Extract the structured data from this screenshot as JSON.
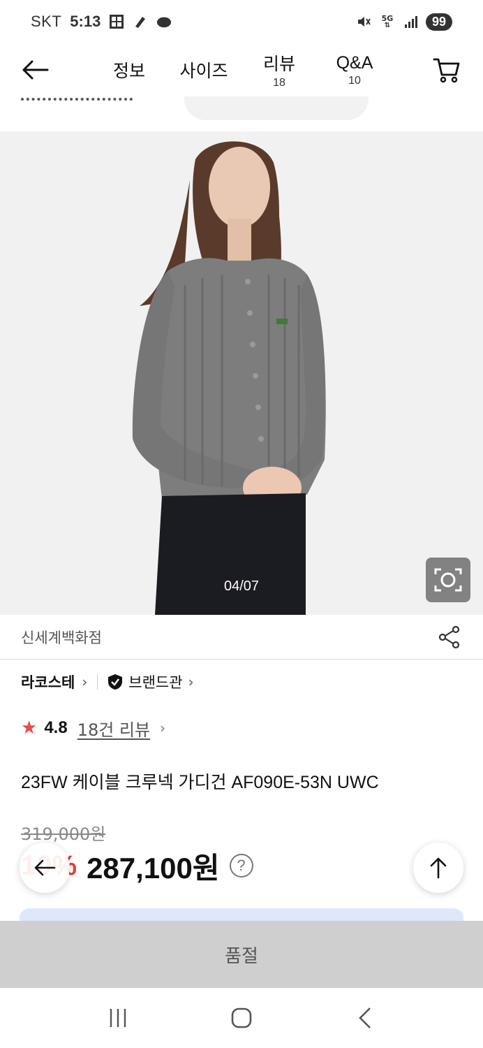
{
  "status_bar": {
    "carrier": "SKT",
    "time": "5:13",
    "network": "5G",
    "battery": "99"
  },
  "nav": {
    "tabs": [
      {
        "label": "정보",
        "count": ""
      },
      {
        "label": "사이즈",
        "count": ""
      },
      {
        "label": "리뷰",
        "count": "18"
      },
      {
        "label": "Q&A",
        "count": "10"
      }
    ]
  },
  "hero": {
    "counter": "04/07"
  },
  "product": {
    "store": "신세계백화점",
    "brand": "라코스테",
    "brand_hall": "브랜드관",
    "rating": "4.8",
    "review_link": "18건 리뷰",
    "title": "23FW 케이블 크루넥 가디건 AF090E-53N UWC",
    "original_price": "319,000원",
    "discount": "10%",
    "sale_price": "287,100원",
    "help_symbol": "?"
  },
  "actions": {
    "sold_out_label": "품절"
  },
  "colors": {
    "accent_red": "#ee3a3a",
    "star": "#e84b4b",
    "sold_out_bg": "#cfcfcf",
    "image_bg": "#f1f1f1"
  }
}
